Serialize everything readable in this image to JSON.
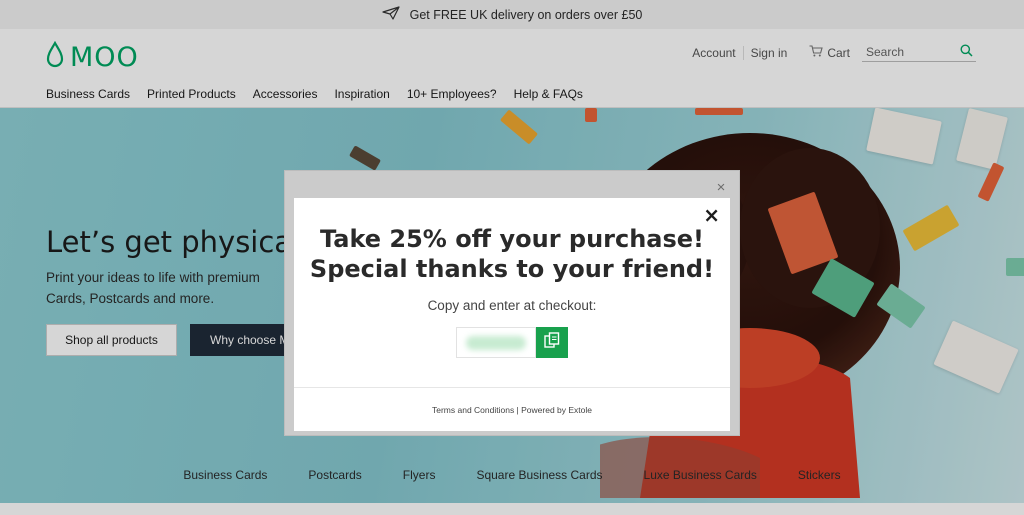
{
  "promo": {
    "text": "Get FREE UK delivery on orders over £50",
    "icon": "paper-plane-icon"
  },
  "header": {
    "logo": "MOO",
    "account": "Account",
    "sign_in": "Sign in",
    "cart": "Cart",
    "search_placeholder": "Search"
  },
  "nav": [
    "Business Cards",
    "Printed Products",
    "Accessories",
    "Inspiration",
    "10+ Employees?",
    "Help & FAQs"
  ],
  "hero": {
    "title": "Let’s get physical",
    "subtitle": "Print your ideas to life with premium Cards, Postcards and more.",
    "shop_button": "Shop all products",
    "why_button": "Why choose M"
  },
  "categories": [
    "Business Cards",
    "Postcards",
    "Flyers",
    "Square Business Cards",
    "Luxe Business Cards",
    "Stickers"
  ],
  "modal": {
    "headline": "Take 25% off your purchase! Special thanks to your friend!",
    "instruction": "Copy and enter at checkout:",
    "footer": "Terms and Conditions | Powered by Extole",
    "close": "×",
    "outer_close": "×"
  },
  "colors": {
    "brand_green": "#00a665",
    "copy_green": "#18a14d",
    "dark_button": "#1f2b3a"
  }
}
